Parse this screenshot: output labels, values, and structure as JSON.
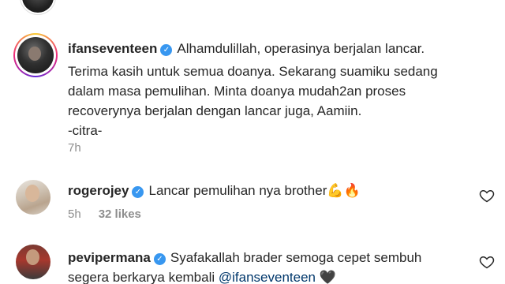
{
  "comments": [
    {
      "username": "ifanseventeen",
      "lines": [
        "Alhamdulillah, operasinya berjalan lancar.",
        "Terima kasih untuk semua doanya. Sekarang suamiku sedang",
        "dalam masa pemulihan. Minta doanya mudah2an proses",
        "recoverynya berjalan dengan lancar juga, Aamiin.",
        "-citra-"
      ],
      "time": "7h"
    },
    {
      "username": "rogerojey",
      "text": "Lancar pemulihan nya brother",
      "emoji": "💪🔥",
      "time": "5h",
      "likes": "32 likes"
    },
    {
      "username": "pevipermana",
      "text": "Syafakallah brader semoga cepet sembuh",
      "line2": "segera berkarya kembali",
      "mention": "@ifanseventeen",
      "emoji": "🖤"
    }
  ],
  "icons": {
    "verified": "verified-badge-icon",
    "like": "heart-outline-icon"
  },
  "colors": {
    "verified": "#3897f0",
    "meta": "#8e8e8e",
    "mention": "#00376b"
  }
}
